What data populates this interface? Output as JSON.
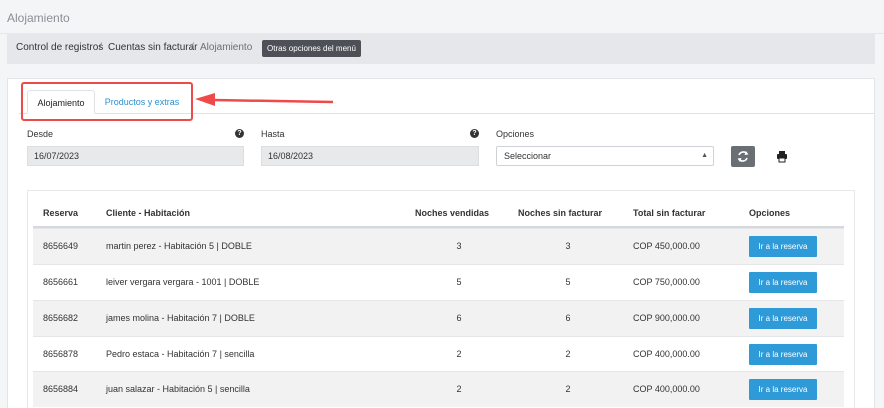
{
  "page": {
    "title": "Alojamiento"
  },
  "breadcrumb": {
    "items": [
      "Control de registros",
      "Cuentas sin facturar",
      "Alojamiento"
    ],
    "separator": "/",
    "menu_button": "Otras opciones del menú"
  },
  "tabs": [
    {
      "label": "Alojamiento",
      "active": true
    },
    {
      "label": "Productos y extras",
      "active": false
    }
  ],
  "filters": {
    "desde_label": "Desde",
    "desde_value": "16/07/2023",
    "hasta_label": "Hasta",
    "hasta_value": "16/08/2023",
    "opciones_label": "Opciones",
    "opciones_selected": "Seleccionar",
    "help_glyph": "?"
  },
  "table": {
    "headers": [
      "Reserva",
      "Cliente - Habitación",
      "Noches vendidas",
      "Noches sin facturar",
      "Total sin facturar",
      "Opciones"
    ],
    "rows": [
      {
        "reserva": "8656649",
        "cliente": "martin perez - Habitación 5 | DOBLE",
        "vendidas": "3",
        "sin_facturar": "3",
        "total": "COP 450,000.00",
        "action": "Ir a la reserva"
      },
      {
        "reserva": "8656661",
        "cliente": "leiver vergara vergara - 1001 | DOBLE",
        "vendidas": "5",
        "sin_facturar": "5",
        "total": "COP 750,000.00",
        "action": "Ir a la reserva"
      },
      {
        "reserva": "8656682",
        "cliente": "james molina - Habitación 7 | DOBLE",
        "vendidas": "6",
        "sin_facturar": "6",
        "total": "COP 900,000.00",
        "action": "Ir a la reserva"
      },
      {
        "reserva": "8656878",
        "cliente": "Pedro estaca - Habitación 7 | sencilla",
        "vendidas": "2",
        "sin_facturar": "2",
        "total": "COP 400,000.00",
        "action": "Ir a la reserva"
      },
      {
        "reserva": "8656884",
        "cliente": "juan salazar - Habitación 5 | sencilla",
        "vendidas": "2",
        "sin_facturar": "2",
        "total": "COP 400,000.00",
        "action": "Ir a la reserva"
      }
    ]
  },
  "colors": {
    "accent": "#2f9ad8",
    "annotation": "#ef4a4a",
    "dark_button": "#4d5157"
  },
  "icons": {
    "refresh": "refresh-icon",
    "print": "print-icon",
    "help": "help-icon",
    "arrow": "annotation-arrow"
  }
}
